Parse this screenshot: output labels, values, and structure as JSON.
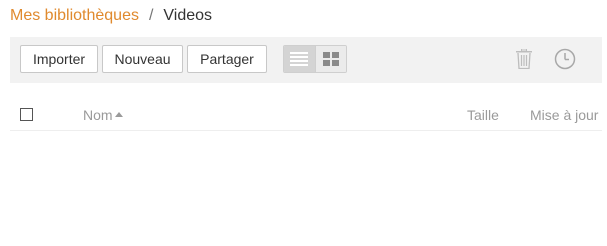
{
  "breadcrumb": {
    "root": "Mes bibliothèques",
    "separator": "/",
    "current": "Videos"
  },
  "toolbar": {
    "import_label": "Importer",
    "new_label": "Nouveau",
    "share_label": "Partager",
    "view_modes": [
      "list-view-icon",
      "grid-view-icon"
    ],
    "active_view": "list",
    "actions": [
      "trash-icon",
      "history-clock-icon"
    ]
  },
  "table": {
    "columns": {
      "name": "Nom",
      "size": "Taille",
      "updated": "Mise à jour"
    },
    "sort": {
      "column": "name",
      "direction": "ascending"
    },
    "rows": []
  },
  "colors": {
    "accent": "#e08a2e",
    "toolbar_bg": "#f2f2f2",
    "muted_text": "#9a9a9a"
  }
}
